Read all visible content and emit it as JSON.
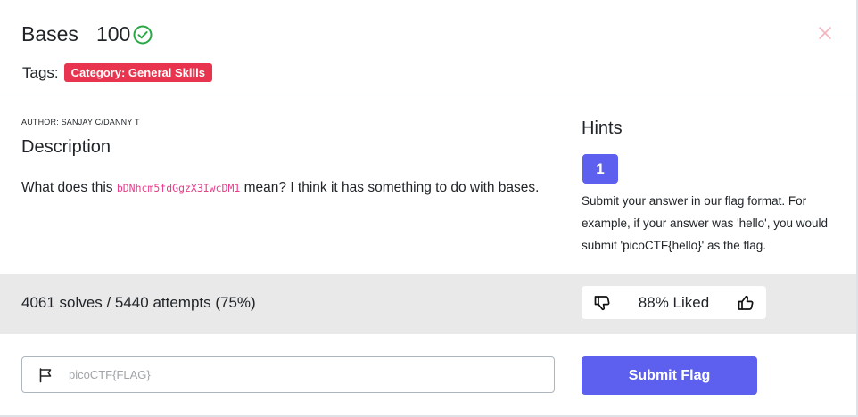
{
  "header": {
    "title": "Bases",
    "points": "100",
    "tags_label": "Tags:",
    "tag": "Category: General Skills"
  },
  "description": {
    "author": "AUTHOR: SANJAY C/DANNY T",
    "heading": "Description",
    "text_before": "What does this ",
    "code": "bDNhcm5fdGgzX3IwcDM1",
    "text_after": " mean? I think it has something to do with bases."
  },
  "hints": {
    "heading": "Hints",
    "button_label": "1",
    "text": "Submit your answer in our flag format. For example, if your answer was 'hello', you would submit 'picoCTF{hello}' as the flag."
  },
  "stats": {
    "solves": "4061 solves / 5440 attempts (75%)",
    "liked": "88% Liked"
  },
  "flag": {
    "placeholder": "picoCTF{FLAG}",
    "submit_label": "Submit Flag"
  },
  "colors": {
    "accent": "#5d5fef",
    "tag": "#e8344e",
    "check": "#28a745",
    "code": "#e83e8c"
  }
}
